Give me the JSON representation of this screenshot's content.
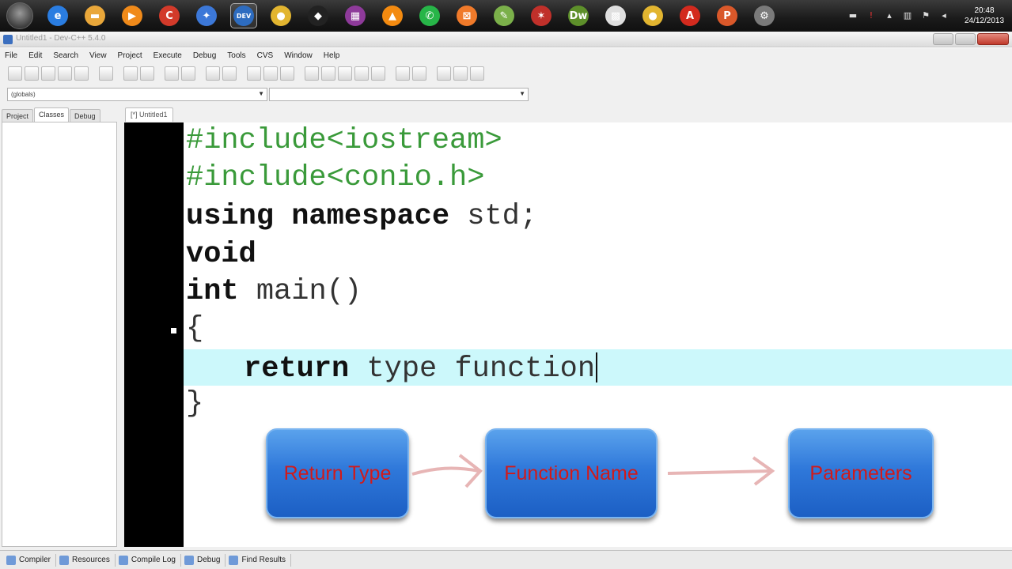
{
  "window": {
    "title": "Untitled1 - Dev-C++ 5.4.0"
  },
  "taskbar": {
    "apps": [
      {
        "icon": "internet-explorer-icon",
        "glyph": "e",
        "color": "#2a7de1"
      },
      {
        "icon": "folder-icon",
        "glyph": "▬",
        "color": "#e9a73a"
      },
      {
        "icon": "media-player-icon",
        "glyph": "▶",
        "color": "#f08a1a"
      },
      {
        "icon": "ccleaner-icon",
        "glyph": "C",
        "color": "#d23a2a"
      },
      {
        "icon": "app-icon",
        "glyph": "✦",
        "color": "#3c78d8"
      },
      {
        "icon": "dev-cpp-icon",
        "glyph": "DEV",
        "color": "#2d6cc0"
      },
      {
        "icon": "chrome-icon",
        "glyph": "●",
        "color": "#e2b530"
      },
      {
        "icon": "inkscape-icon",
        "glyph": "◆",
        "color": "#222222"
      },
      {
        "icon": "winrar-icon",
        "glyph": "▦",
        "color": "#8e3a9a"
      },
      {
        "icon": "vlc-icon",
        "glyph": "▲",
        "color": "#f38a10"
      },
      {
        "icon": "whatsapp-icon",
        "glyph": "✆",
        "color": "#27b548"
      },
      {
        "icon": "xampp-icon",
        "glyph": "⊠",
        "color": "#f07a2a"
      },
      {
        "icon": "notepad-icon",
        "glyph": "✎",
        "color": "#7bb04a"
      },
      {
        "icon": "app-star-icon",
        "glyph": "✶",
        "color": "#c0302a"
      },
      {
        "icon": "dreamweaver-icon",
        "glyph": "Dw",
        "color": "#5d8f2a"
      },
      {
        "icon": "grid-app-icon",
        "glyph": "▩",
        "color": "#dfdfdf"
      },
      {
        "icon": "chrome-icon",
        "glyph": "●",
        "color": "#e2b530"
      },
      {
        "icon": "acrobat-icon",
        "glyph": "A",
        "color": "#d32a1e"
      },
      {
        "icon": "powerpoint-icon",
        "glyph": "P",
        "color": "#d9582a"
      },
      {
        "icon": "tools-icon",
        "glyph": "⚙",
        "color": "#7a7a7a"
      }
    ],
    "clock_time": "20:48",
    "clock_date": "24/12/2013"
  },
  "menu": [
    "File",
    "Edit",
    "Search",
    "View",
    "Project",
    "Execute",
    "Debug",
    "Tools",
    "CVS",
    "Window",
    "Help"
  ],
  "combo": {
    "scope": "(globals)",
    "member": ""
  },
  "left_tabs": [
    "Project",
    "Classes",
    "Debug"
  ],
  "editor_tab": "[*] Untitled1",
  "code": {
    "line1": "#include<iostream>",
    "line2": "#include<conio.h>",
    "line3_kw": "using namespace",
    "line3_rest": " std;",
    "line4_kw": "void",
    "line5_kw": "int",
    "line5_rest": " main()",
    "line6": "{",
    "line7_kw": "return",
    "line7_rest": " type function",
    "line8": "}"
  },
  "diagram": {
    "box1": "Return Type",
    "box2": "Function Name",
    "box3": "Parameters"
  },
  "status_tabs": [
    "Compiler",
    "Resources",
    "Compile Log",
    "Debug",
    "Find Results"
  ]
}
